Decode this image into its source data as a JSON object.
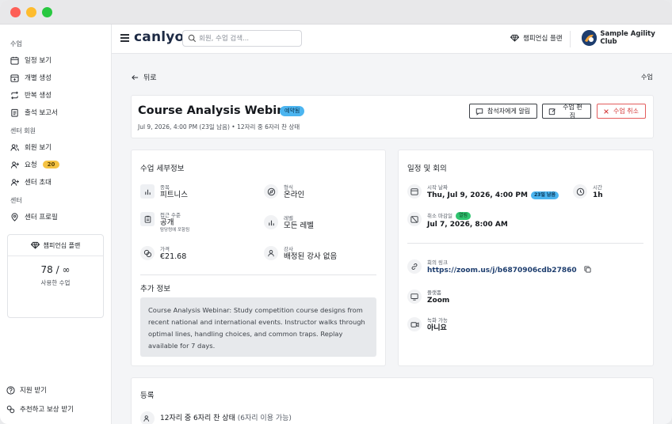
{
  "app": {
    "logo": "canlyo",
    "search_placeholder": "회원, 수업 검색...",
    "plan_link": "챔피언십 플랜",
    "club_name": "Sample Agility Club"
  },
  "sidebar": {
    "sections": [
      {
        "title": "수업",
        "items": [
          {
            "label": "일정 보기",
            "icon": "calendar-icon"
          },
          {
            "label": "개별 생성",
            "icon": "calendar-plus-icon"
          },
          {
            "label": "반복 생성",
            "icon": "repeat-icon"
          },
          {
            "label": "출석 보고서",
            "icon": "list-icon"
          }
        ]
      },
      {
        "title": "센터 회원",
        "items": [
          {
            "label": "회원 보기",
            "icon": "users-icon"
          },
          {
            "label": "요청",
            "icon": "user-plus-icon",
            "badge": "20"
          },
          {
            "label": "센터 초대",
            "icon": "user-add-icon"
          }
        ]
      },
      {
        "title": "센터",
        "items": [
          {
            "label": "센터 프로필",
            "icon": "map-pin-icon"
          }
        ]
      }
    ],
    "plan_card": {
      "title": "챔피언십 플랜",
      "usage": "78 / ∞",
      "usage_label": "사용한 수업"
    },
    "footer": {
      "support": "지원 받기",
      "refer": "추천하고 보상 받기"
    }
  },
  "page": {
    "back": "뒤로",
    "breadcrumb": "수업",
    "title": "Course Analysis Webinar",
    "status": "예약됨",
    "subtitle": "Jul 9, 2026, 4:00 PM (23일 남음) • 12자리 중 6자리 찬 상태",
    "buttons": {
      "notify": "참석자에게 알림",
      "edit": "수업 편집",
      "cancel": "수업 취소"
    }
  },
  "details": {
    "title": "수업 세부정보",
    "fields": {
      "type": {
        "label": "종목",
        "value": "피트니스"
      },
      "format": {
        "label": "형식",
        "value": "온라인"
      },
      "access": {
        "label": "접근 수준",
        "value": "공개",
        "note": "탐당렁에 포함됨"
      },
      "level": {
        "label": "레벨",
        "value": "모든 레벨"
      },
      "price": {
        "label": "가격",
        "value": "€21.68"
      },
      "instructor": {
        "label": "강사",
        "value": "배정된 강사 없음"
      }
    },
    "extra_title": "추가 정보",
    "description": "Course Analysis Webinar: Study competition course designs from recent national and international events. Instructor walks through optimal lines, handling choices, and common traps. Replay available for 7 days."
  },
  "schedule": {
    "title": "일정 및 회의",
    "start": {
      "label": "시작 날짜",
      "value": "Thu, Jul 9, 2026, 4:00 PM",
      "chip": "23일 남음"
    },
    "duration": {
      "label": "시간",
      "value": "1h"
    },
    "cancel_deadline": {
      "label": "취소 마감일",
      "chip": "열림",
      "value": "Jul 7, 2026, 8:00 AM"
    },
    "meeting_link": {
      "label": "회의 링크",
      "value": "https://zoom.us/j/b6870906cdb27860"
    },
    "platform": {
      "label": "플랫폼",
      "value": "Zoom"
    },
    "recording": {
      "label": "녹화 가능",
      "value": "아니요"
    }
  },
  "registration": {
    "title": "등록",
    "summary": "12자리 중 6자리 찬 상태",
    "available": "(6자리 이용 가능)"
  },
  "colors": {
    "accent": "#4cb5f0",
    "danger": "#d43b3b",
    "success": "#2fc46f",
    "badge": "#f5c343"
  }
}
